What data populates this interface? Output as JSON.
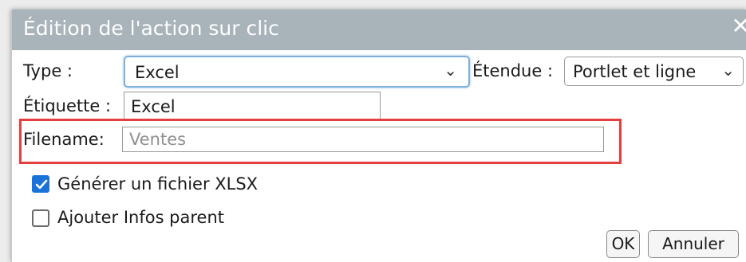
{
  "dialog": {
    "title": "Édition de l'action sur clic",
    "close_glyph": "✕"
  },
  "form": {
    "type_label": "Type :",
    "type_value": "Excel",
    "scope_label": "Étendue :",
    "scope_value": "Portlet et ligne",
    "label_label": "Étiquette :",
    "label_value": "Excel",
    "filename_label": "Filename:",
    "filename_placeholder": "Ventes",
    "xlsx_label": "Générer un fichier XLSX",
    "xlsx_checked": true,
    "parent_label": "Ajouter Infos parent",
    "parent_checked": false
  },
  "buttons": {
    "ok_label": "OK",
    "cancel_label": "Annuler"
  },
  "colors": {
    "titlebar": "#a9b3ba",
    "highlight": "#e53e3e",
    "checkbox_accent": "#1a73d8"
  },
  "icons": {
    "close": "close-icon",
    "dropdown": "chevron-down-icon",
    "check": "check-icon"
  }
}
